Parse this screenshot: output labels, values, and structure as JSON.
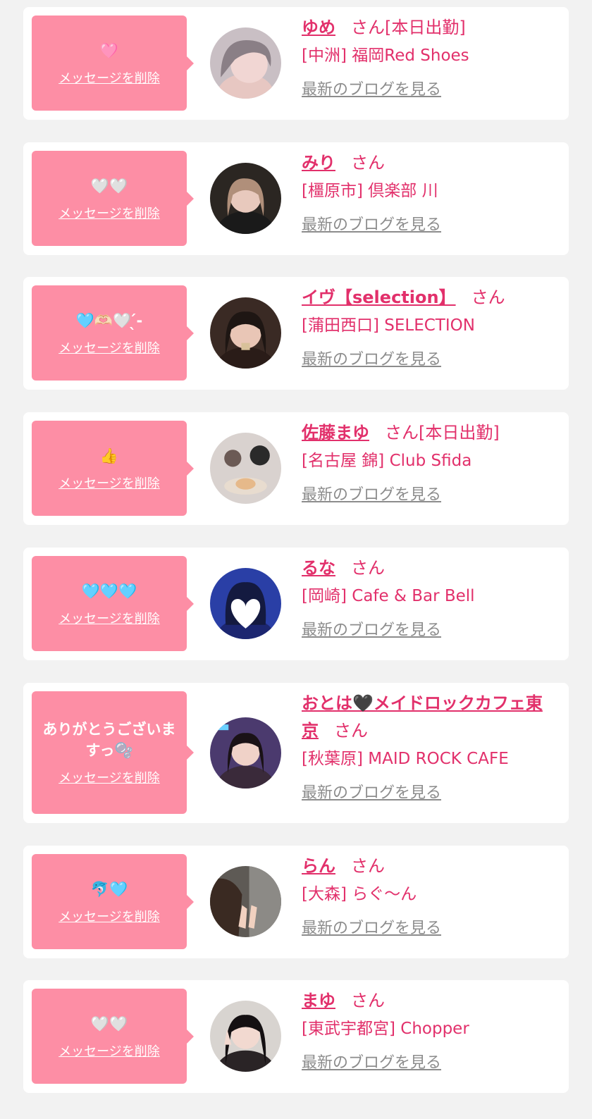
{
  "colors": {
    "background": "#f2f2f2",
    "card": "#ffffff",
    "bubble": "#fd8ea5",
    "accent": "#e2306b",
    "blog_link": "#8c8c8c"
  },
  "delete_label": "メッセージを削除",
  "blog_label": "最新のブログを見る",
  "entries": [
    {
      "message": "🩷",
      "name": "ゆめ",
      "suffix": "さん[本日出勤]",
      "shop": "[中洲] 福岡Red Shoes",
      "avatar_icon": "girl-portrait"
    },
    {
      "message": "🤍🤍",
      "name": "みり",
      "suffix": "さん",
      "shop": "[橿原市] 倶楽部 川",
      "avatar_icon": "girl-portrait"
    },
    {
      "message": "🩵🫶🏻🤍 ̖́-",
      "name": "イヴ【selection】",
      "suffix": "さん",
      "shop": "[蒲田西口] SELECTION",
      "avatar_icon": "girl-portrait"
    },
    {
      "message": "👍",
      "name": "佐藤まゆ",
      "suffix": "さん[本日出勤]",
      "shop": "[名古屋 錦] Club Sfida",
      "avatar_icon": "girl-portrait"
    },
    {
      "message": "🩵🩵🩵",
      "name": "るな",
      "suffix": "さん",
      "shop": "[岡崎] Cafe & Bar Bell",
      "avatar_icon": "girl-portrait"
    },
    {
      "message": "ありがとうございますっ🫧",
      "name": "おとは🖤メイドロックカフェ東京",
      "suffix": "さん",
      "shop": "[秋葉原] MAID ROCK CAFE",
      "avatar_icon": "girl-portrait"
    },
    {
      "message": "🐬🩵",
      "name": "らん",
      "suffix": "さん",
      "shop": "[大森] らぐ〜ん",
      "avatar_icon": "girl-portrait"
    },
    {
      "message": "🤍🤍",
      "name": "まゆ",
      "suffix": "さん",
      "shop": "[東武宇都宮] Chopper",
      "avatar_icon": "girl-portrait"
    }
  ]
}
